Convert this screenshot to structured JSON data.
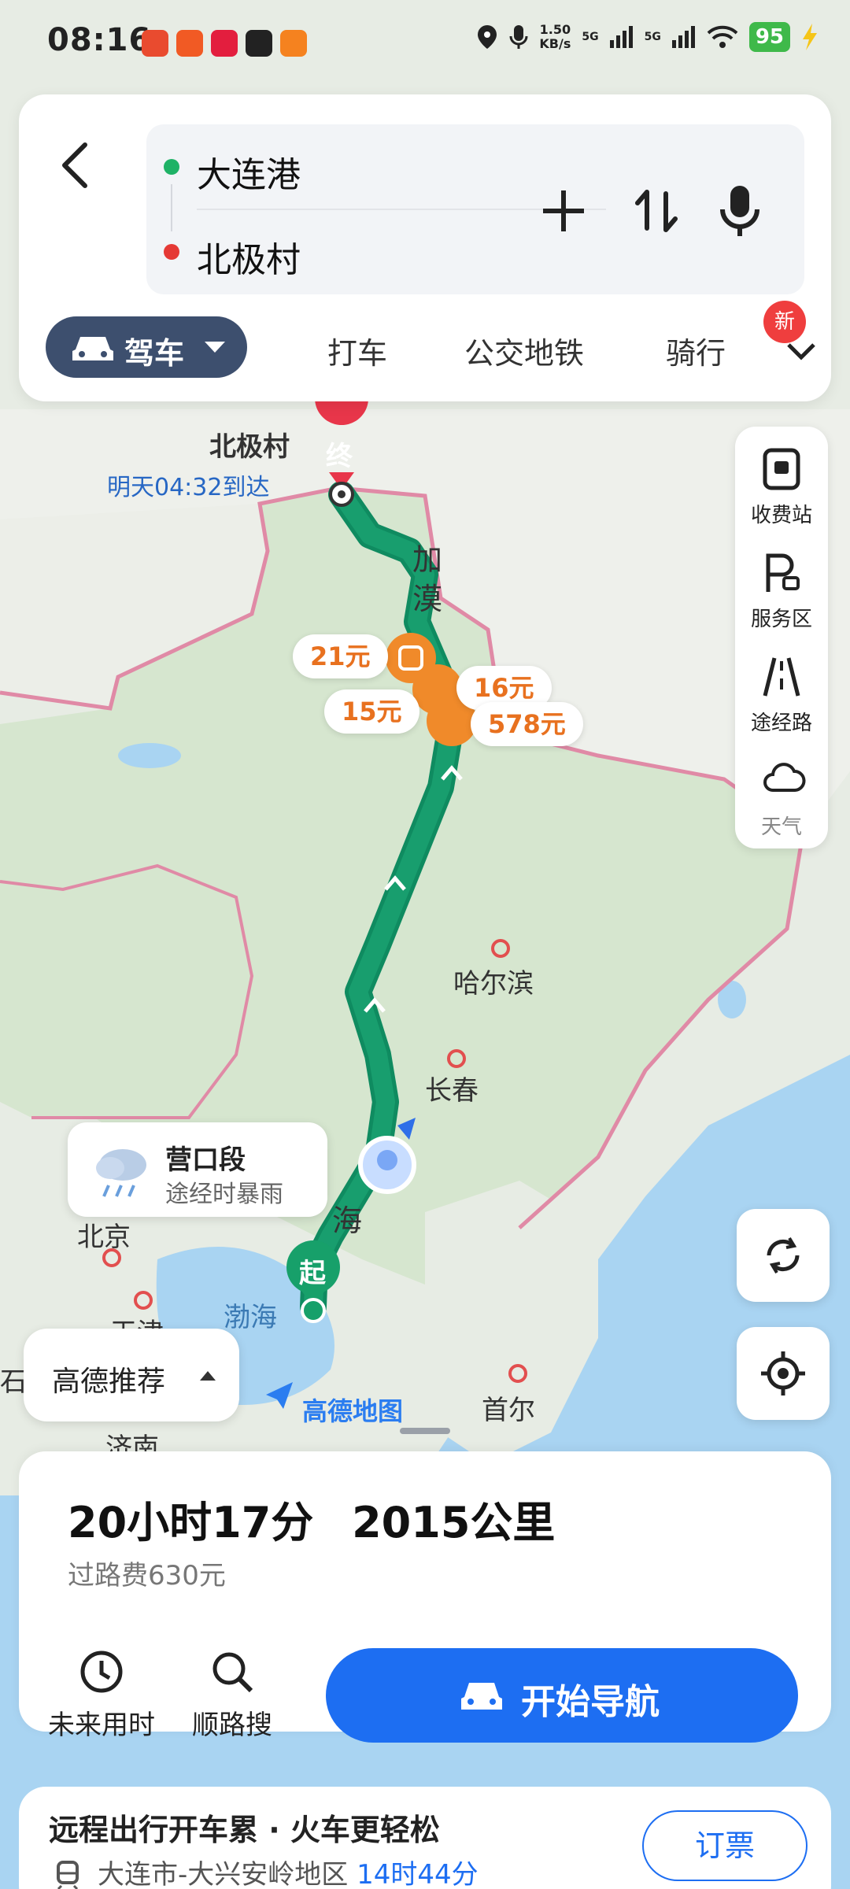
{
  "status_bar": {
    "time": "08:16",
    "speed_value": "1.50",
    "speed_unit": "KB/s",
    "sig1": "5G",
    "sig2": "5G",
    "battery": "95"
  },
  "search": {
    "start": "大连港",
    "end": "北极村"
  },
  "tabs": {
    "active": "驾车",
    "taxi": "打车",
    "transit": "公交地铁",
    "bike": "骑行",
    "new_badge": "新"
  },
  "side_panel": {
    "toll_station": "收费站",
    "service_area": "服务区",
    "via_road": "途经路",
    "weather": "天气"
  },
  "map": {
    "dest_name": "北极村",
    "dest_marker": "终",
    "arrival": "明天04:32到达",
    "start_marker": "起",
    "road_1": "加",
    "road_2": "漠",
    "road_3": "海",
    "fees": [
      "21元",
      "16元",
      "15元",
      "578元"
    ],
    "cities": {
      "harbin": "哈尔滨",
      "changchun": "长春",
      "beijing": "北京",
      "tianjin": "天津",
      "jinan": "济南",
      "seoul": "首尔",
      "bohai": "渤海",
      "shi": "石"
    },
    "weather_segment": "营口段",
    "weather_desc": "途经时暴雨",
    "logo": "高德地图",
    "recommend": "高德推荐"
  },
  "summary": {
    "duration": "20小时17分",
    "distance": "2015公里",
    "toll": "过路费630元"
  },
  "actions": {
    "future": "未来用时",
    "along": "顺路搜",
    "start_nav": "开始导航"
  },
  "promo": {
    "title": "远程出行开车累 · 火车更轻松",
    "route": "大连市-大兴安岭地区",
    "train_time": "14时44分",
    "ticket": "订票"
  }
}
